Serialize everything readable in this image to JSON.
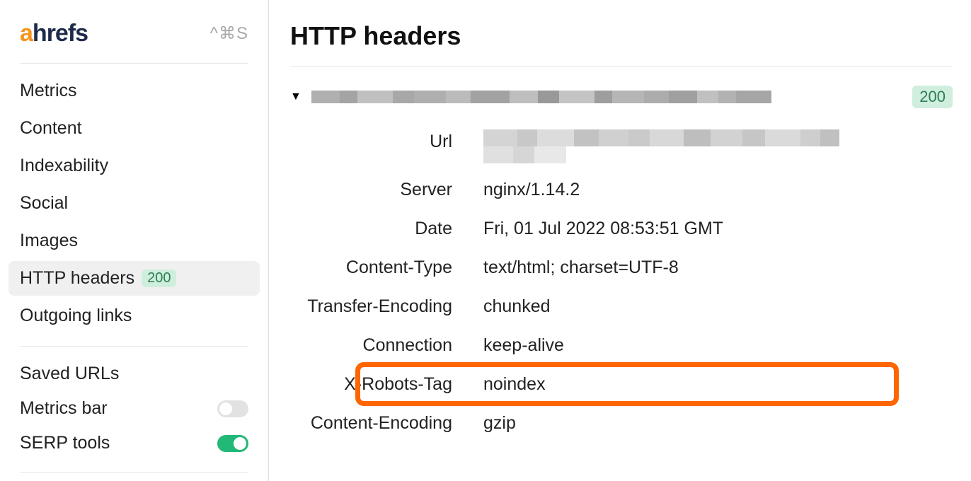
{
  "sidebar": {
    "logo_a": "a",
    "logo_rest": "hrefs",
    "shortcut": "^⌘S",
    "nav": [
      {
        "label": "Metrics"
      },
      {
        "label": "Content"
      },
      {
        "label": "Indexability"
      },
      {
        "label": "Social"
      },
      {
        "label": "Images"
      },
      {
        "label": "HTTP headers",
        "badge": "200"
      },
      {
        "label": "Outgoing links"
      }
    ],
    "saved_urls_label": "Saved URLs",
    "toggles": [
      {
        "label": "Metrics bar",
        "on": false
      },
      {
        "label": "SERP tools",
        "on": true
      }
    ]
  },
  "main": {
    "title": "HTTP headers",
    "status_code": "200",
    "headers": [
      {
        "key": "Url",
        "value": ""
      },
      {
        "key": "Server",
        "value": "nginx/1.14.2"
      },
      {
        "key": "Date",
        "value": "Fri, 01 Jul 2022 08:53:51 GMT"
      },
      {
        "key": "Content-Type",
        "value": "text/html; charset=UTF-8"
      },
      {
        "key": "Transfer-Encoding",
        "value": "chunked"
      },
      {
        "key": "Connection",
        "value": "keep-alive"
      },
      {
        "key": "X-Robots-Tag",
        "value": "noindex"
      },
      {
        "key": "Content-Encoding",
        "value": "gzip"
      }
    ]
  }
}
